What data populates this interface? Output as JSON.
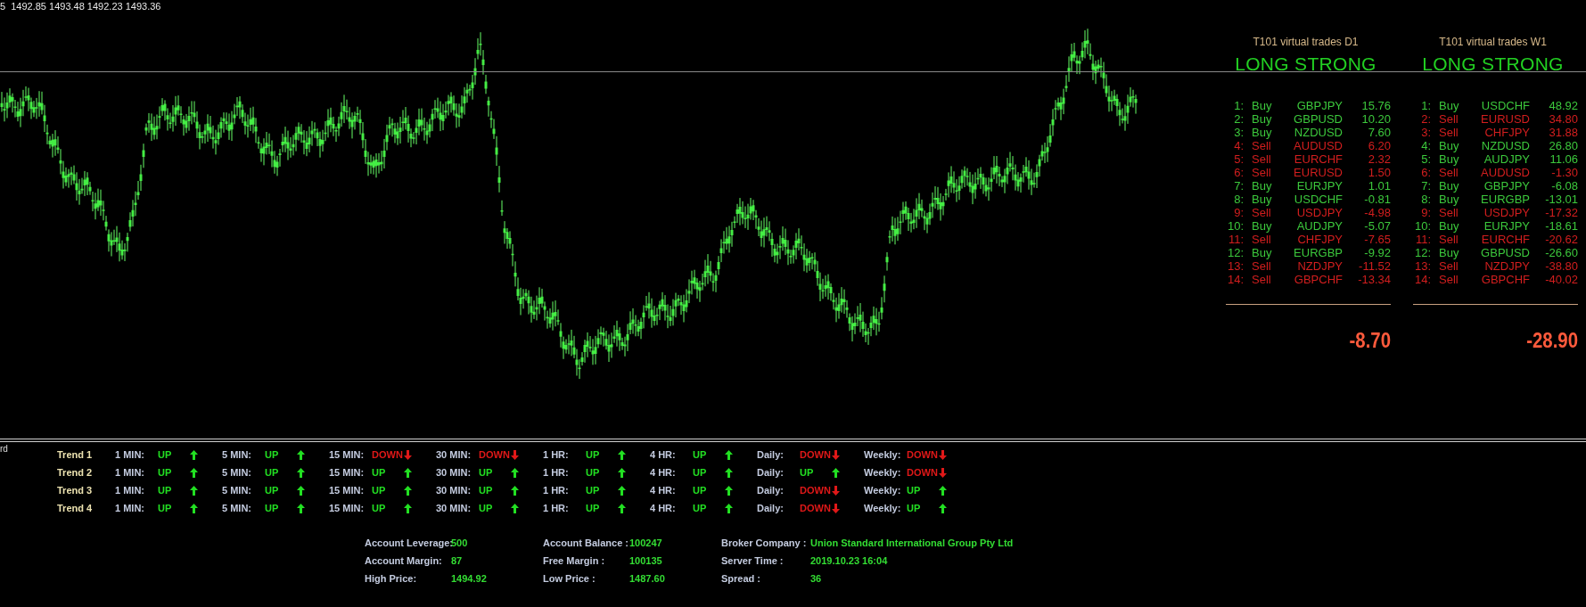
{
  "chart": {
    "ohlc_label": "5  1492.85 1493.48 1492.23 1493.36"
  },
  "panels": [
    {
      "title": "T101 virtual trades D1",
      "signal": "LONG STRONG",
      "total": "-8.70",
      "trades": [
        {
          "n": "1:",
          "side": "Buy",
          "symbol": "GBPJPY",
          "value": "15.76",
          "kind": "buy"
        },
        {
          "n": "2:",
          "side": "Buy",
          "symbol": "GBPUSD",
          "value": "10.20",
          "kind": "buy"
        },
        {
          "n": "3:",
          "side": "Buy",
          "symbol": "NZDUSD",
          "value": "7.60",
          "kind": "buy"
        },
        {
          "n": "4:",
          "side": "Sell",
          "symbol": "AUDUSD",
          "value": "6.20",
          "kind": "sell"
        },
        {
          "n": "5:",
          "side": "Sell",
          "symbol": "EURCHF",
          "value": "2.32",
          "kind": "sell"
        },
        {
          "n": "6:",
          "side": "Sell",
          "symbol": "EURUSD",
          "value": "1.50",
          "kind": "sell"
        },
        {
          "n": "7:",
          "side": "Buy",
          "symbol": "EURJPY",
          "value": "1.01",
          "kind": "buy"
        },
        {
          "n": "8:",
          "side": "Buy",
          "symbol": "USDCHF",
          "value": "-0.81",
          "kind": "buy"
        },
        {
          "n": "9:",
          "side": "Sell",
          "symbol": "USDJPY",
          "value": "-4.98",
          "kind": "sell"
        },
        {
          "n": "10:",
          "side": "Buy",
          "symbol": "AUDJPY",
          "value": "-5.07",
          "kind": "buy"
        },
        {
          "n": "11:",
          "side": "Sell",
          "symbol": "CHFJPY",
          "value": "-7.65",
          "kind": "sell"
        },
        {
          "n": "12:",
          "side": "Buy",
          "symbol": "EURGBP",
          "value": "-9.92",
          "kind": "buy"
        },
        {
          "n": "13:",
          "side": "Sell",
          "symbol": "NZDJPY",
          "value": "-11.52",
          "kind": "sell"
        },
        {
          "n": "14:",
          "side": "Sell",
          "symbol": "GBPCHF",
          "value": "-13.34",
          "kind": "sell"
        }
      ]
    },
    {
      "title": "T101 virtual trades W1",
      "signal": "LONG STRONG",
      "total": "-28.90",
      "trades": [
        {
          "n": "1:",
          "side": "Buy",
          "symbol": "USDCHF",
          "value": "48.92",
          "kind": "buy"
        },
        {
          "n": "2:",
          "side": "Sell",
          "symbol": "EURUSD",
          "value": "34.80",
          "kind": "sell"
        },
        {
          "n": "3:",
          "side": "Sell",
          "symbol": "CHFJPY",
          "value": "31.88",
          "kind": "sell"
        },
        {
          "n": "4:",
          "side": "Buy",
          "symbol": "NZDUSD",
          "value": "26.80",
          "kind": "buy"
        },
        {
          "n": "5:",
          "side": "Buy",
          "symbol": "AUDJPY",
          "value": "11.06",
          "kind": "buy"
        },
        {
          "n": "6:",
          "side": "Sell",
          "symbol": "AUDUSD",
          "value": "-1.30",
          "kind": "sell"
        },
        {
          "n": "7:",
          "side": "Buy",
          "symbol": "GBPJPY",
          "value": "-6.08",
          "kind": "buy"
        },
        {
          "n": "8:",
          "side": "Buy",
          "symbol": "EURGBP",
          "value": "-13.01",
          "kind": "buy"
        },
        {
          "n": "9:",
          "side": "Sell",
          "symbol": "USDJPY",
          "value": "-17.32",
          "kind": "sell"
        },
        {
          "n": "10:",
          "side": "Buy",
          "symbol": "EURJPY",
          "value": "-18.61",
          "kind": "buy"
        },
        {
          "n": "11:",
          "side": "Sell",
          "symbol": "EURCHF",
          "value": "-20.62",
          "kind": "sell"
        },
        {
          "n": "12:",
          "side": "Buy",
          "symbol": "GBPUSD",
          "value": "-26.60",
          "kind": "buy"
        },
        {
          "n": "13:",
          "side": "Sell",
          "symbol": "NZDJPY",
          "value": "-38.80",
          "kind": "sell"
        },
        {
          "n": "14:",
          "side": "Sell",
          "symbol": "GBPCHF",
          "value": "-40.02",
          "kind": "sell"
        }
      ]
    }
  ],
  "trend": {
    "edge_label": "rd",
    "rows": [
      {
        "label": "Trend 1",
        "cells": [
          {
            "timeframe": "1 MIN:",
            "value": "UP",
            "kind": "up"
          },
          {
            "timeframe": "5 MIN:",
            "value": "UP",
            "kind": "up"
          },
          {
            "timeframe": "15 MIN:",
            "value": "DOWN",
            "kind": "down"
          },
          {
            "timeframe": "30 MIN:",
            "value": "DOWN",
            "kind": "down"
          },
          {
            "timeframe": "1 HR:",
            "value": "UP",
            "kind": "up"
          },
          {
            "timeframe": "4 HR:",
            "value": "UP",
            "kind": "up"
          },
          {
            "timeframe": "Daily:",
            "value": "DOWN",
            "kind": "down"
          },
          {
            "timeframe": "Weekly:",
            "value": "DOWN",
            "kind": "down"
          }
        ]
      },
      {
        "label": "Trend 2",
        "cells": [
          {
            "timeframe": "1 MIN:",
            "value": "UP",
            "kind": "up"
          },
          {
            "timeframe": "5 MIN:",
            "value": "UP",
            "kind": "up"
          },
          {
            "timeframe": "15 MIN:",
            "value": "UP",
            "kind": "up"
          },
          {
            "timeframe": "30 MIN:",
            "value": "UP",
            "kind": "up"
          },
          {
            "timeframe": "1 HR:",
            "value": "UP",
            "kind": "up"
          },
          {
            "timeframe": "4 HR:",
            "value": "UP",
            "kind": "up"
          },
          {
            "timeframe": "Daily:",
            "value": "UP",
            "kind": "up"
          },
          {
            "timeframe": "Weekly:",
            "value": "DOWN",
            "kind": "down"
          }
        ]
      },
      {
        "label": "Trend 3",
        "cells": [
          {
            "timeframe": "1 MIN:",
            "value": "UP",
            "kind": "up"
          },
          {
            "timeframe": "5 MIN:",
            "value": "UP",
            "kind": "up"
          },
          {
            "timeframe": "15 MIN:",
            "value": "UP",
            "kind": "up"
          },
          {
            "timeframe": "30 MIN:",
            "value": "UP",
            "kind": "up"
          },
          {
            "timeframe": "1 HR:",
            "value": "UP",
            "kind": "up"
          },
          {
            "timeframe": "4 HR:",
            "value": "UP",
            "kind": "up"
          },
          {
            "timeframe": "Daily:",
            "value": "DOWN",
            "kind": "down"
          },
          {
            "timeframe": "Weekly:",
            "value": "UP",
            "kind": "up"
          }
        ]
      },
      {
        "label": "Trend 4",
        "cells": [
          {
            "timeframe": "1 MIN:",
            "value": "UP",
            "kind": "up"
          },
          {
            "timeframe": "5 MIN:",
            "value": "UP",
            "kind": "up"
          },
          {
            "timeframe": "15 MIN:",
            "value": "UP",
            "kind": "up"
          },
          {
            "timeframe": "30 MIN:",
            "value": "UP",
            "kind": "up"
          },
          {
            "timeframe": "1 HR:",
            "value": "UP",
            "kind": "up"
          },
          {
            "timeframe": "4 HR:",
            "value": "UP",
            "kind": "up"
          },
          {
            "timeframe": "Daily:",
            "value": "DOWN",
            "kind": "down"
          },
          {
            "timeframe": "Weekly:",
            "value": "UP",
            "kind": "up"
          }
        ]
      }
    ]
  },
  "account": [
    [
      {
        "label": "Account Leverage:",
        "value": "500"
      },
      {
        "label": "Account Margin:",
        "value": "87"
      },
      {
        "label": "High Price:",
        "value": "1494.92"
      }
    ],
    [
      {
        "label": "Account Balance :",
        "value": "100247"
      },
      {
        "label": "Free Margin :",
        "value": "100135"
      },
      {
        "label": "Low Price :",
        "value": "1487.60"
      }
    ],
    [
      {
        "label": "Broker Company :",
        "value": "Union Standard International Group Pty Ltd"
      },
      {
        "label": "Server Time :",
        "value": "2019.10.23 16:04"
      },
      {
        "label": "Spread :",
        "value": "36"
      }
    ]
  ]
}
